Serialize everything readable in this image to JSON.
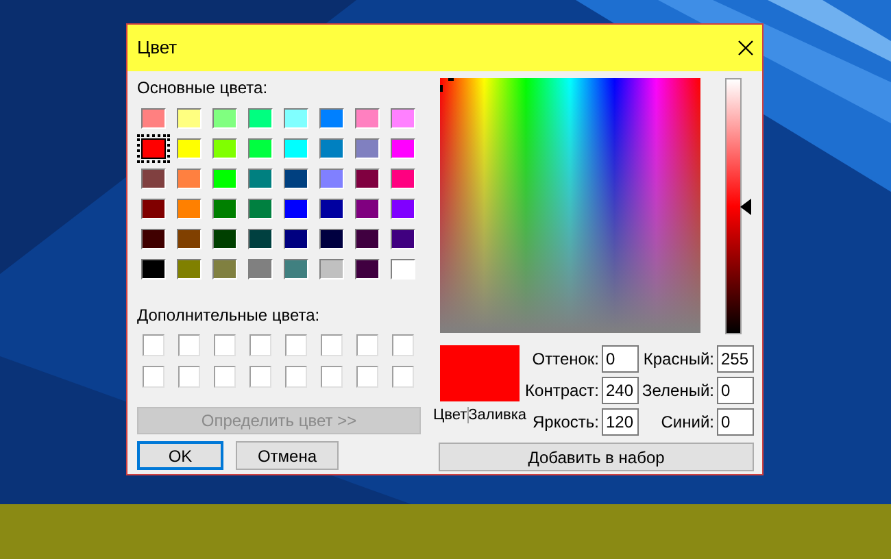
{
  "window": {
    "title": "Цвет"
  },
  "basic_colors": {
    "label": "Основные цвета:",
    "swatches": [
      {
        "color": "#ff8080",
        "selected": false
      },
      {
        "color": "#ffff80",
        "selected": false
      },
      {
        "color": "#80ff80",
        "selected": false
      },
      {
        "color": "#00ff80",
        "selected": false
      },
      {
        "color": "#80ffff",
        "selected": false
      },
      {
        "color": "#0080ff",
        "selected": false
      },
      {
        "color": "#ff80c0",
        "selected": false
      },
      {
        "color": "#ff80ff",
        "selected": false
      },
      {
        "color": "#ff0000",
        "selected": true
      },
      {
        "color": "#ffff00",
        "selected": false
      },
      {
        "color": "#80ff00",
        "selected": false
      },
      {
        "color": "#00ff40",
        "selected": false
      },
      {
        "color": "#00ffff",
        "selected": false
      },
      {
        "color": "#0080c0",
        "selected": false
      },
      {
        "color": "#8080c0",
        "selected": false
      },
      {
        "color": "#ff00ff",
        "selected": false
      },
      {
        "color": "#804040",
        "selected": false
      },
      {
        "color": "#ff8040",
        "selected": false
      },
      {
        "color": "#00ff00",
        "selected": false
      },
      {
        "color": "#008080",
        "selected": false
      },
      {
        "color": "#004080",
        "selected": false
      },
      {
        "color": "#8080ff",
        "selected": false
      },
      {
        "color": "#800040",
        "selected": false
      },
      {
        "color": "#ff0080",
        "selected": false
      },
      {
        "color": "#800000",
        "selected": false
      },
      {
        "color": "#ff8000",
        "selected": false
      },
      {
        "color": "#008000",
        "selected": false
      },
      {
        "color": "#008040",
        "selected": false
      },
      {
        "color": "#0000ff",
        "selected": false
      },
      {
        "color": "#0000a0",
        "selected": false
      },
      {
        "color": "#800080",
        "selected": false
      },
      {
        "color": "#8000ff",
        "selected": false
      },
      {
        "color": "#400000",
        "selected": false
      },
      {
        "color": "#804000",
        "selected": false
      },
      {
        "color": "#004000",
        "selected": false
      },
      {
        "color": "#004040",
        "selected": false
      },
      {
        "color": "#000080",
        "selected": false
      },
      {
        "color": "#000040",
        "selected": false
      },
      {
        "color": "#400040",
        "selected": false
      },
      {
        "color": "#400080",
        "selected": false
      },
      {
        "color": "#000000",
        "selected": false
      },
      {
        "color": "#808000",
        "selected": false
      },
      {
        "color": "#808040",
        "selected": false
      },
      {
        "color": "#808080",
        "selected": false
      },
      {
        "color": "#408080",
        "selected": false
      },
      {
        "color": "#c0c0c0",
        "selected": false
      },
      {
        "color": "#400040",
        "selected": false
      },
      {
        "color": "#ffffff",
        "selected": false
      }
    ]
  },
  "custom_colors": {
    "label": "Дополнительные цвета:",
    "swatches": [
      {
        "color": "#ffffff"
      },
      {
        "color": "#ffffff"
      },
      {
        "color": "#ffffff"
      },
      {
        "color": "#ffffff"
      },
      {
        "color": "#ffffff"
      },
      {
        "color": "#ffffff"
      },
      {
        "color": "#ffffff"
      },
      {
        "color": "#ffffff"
      },
      {
        "color": "#ffffff"
      },
      {
        "color": "#ffffff"
      },
      {
        "color": "#ffffff"
      },
      {
        "color": "#ffffff"
      },
      {
        "color": "#ffffff"
      },
      {
        "color": "#ffffff"
      },
      {
        "color": "#ffffff"
      },
      {
        "color": "#ffffff"
      }
    ]
  },
  "define_button": {
    "label": "Определить цвет >>",
    "disabled": true
  },
  "buttons": [
    {
      "label": "OK",
      "default": true
    },
    {
      "label": "Отмена",
      "default": false
    }
  ],
  "luminance_slider": {
    "level": 0.5
  },
  "preview": {
    "color": "#ff0000",
    "solid_label": "Цвет",
    "fill_label": "Заливка"
  },
  "hsl_fields": [
    {
      "label": "Оттенок:",
      "value": "0"
    },
    {
      "label": "Контраст:",
      "value": "240"
    },
    {
      "label": "Яркость:",
      "value": "120"
    }
  ],
  "rgb_fields": [
    {
      "label": "Красный:",
      "value": "255"
    },
    {
      "label": "Зеленый:",
      "value": "0"
    },
    {
      "label": "Синий:",
      "value": "0"
    }
  ],
  "add_button": {
    "label": "Добавить в набор"
  }
}
